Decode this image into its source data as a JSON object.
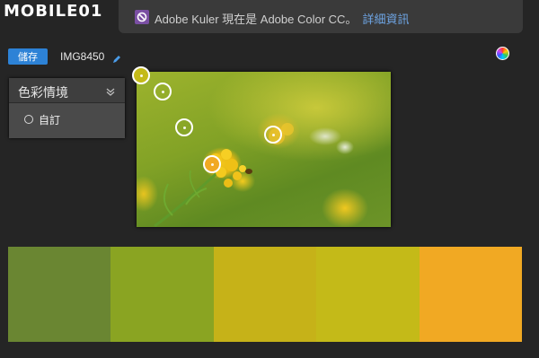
{
  "watermark": "MOBILE01",
  "notice": {
    "text": "Adobe Kuler 現在是 Adobe Color CC。",
    "link": "詳細資訊"
  },
  "toolbar": {
    "save_label": "儲存",
    "file_name": "IMG8450"
  },
  "mood_panel": {
    "title": "色彩情境",
    "items": [
      {
        "label": "自訂"
      }
    ]
  },
  "colors": {
    "accent": "#2d82d6",
    "link": "#6fa6e6"
  },
  "palette": [
    {
      "hex": "#6a8632"
    },
    {
      "hex": "#8aa422"
    },
    {
      "hex": "#c6b218"
    },
    {
      "hex": "#c4ba18"
    },
    {
      "hex": "#f1a923"
    }
  ]
}
